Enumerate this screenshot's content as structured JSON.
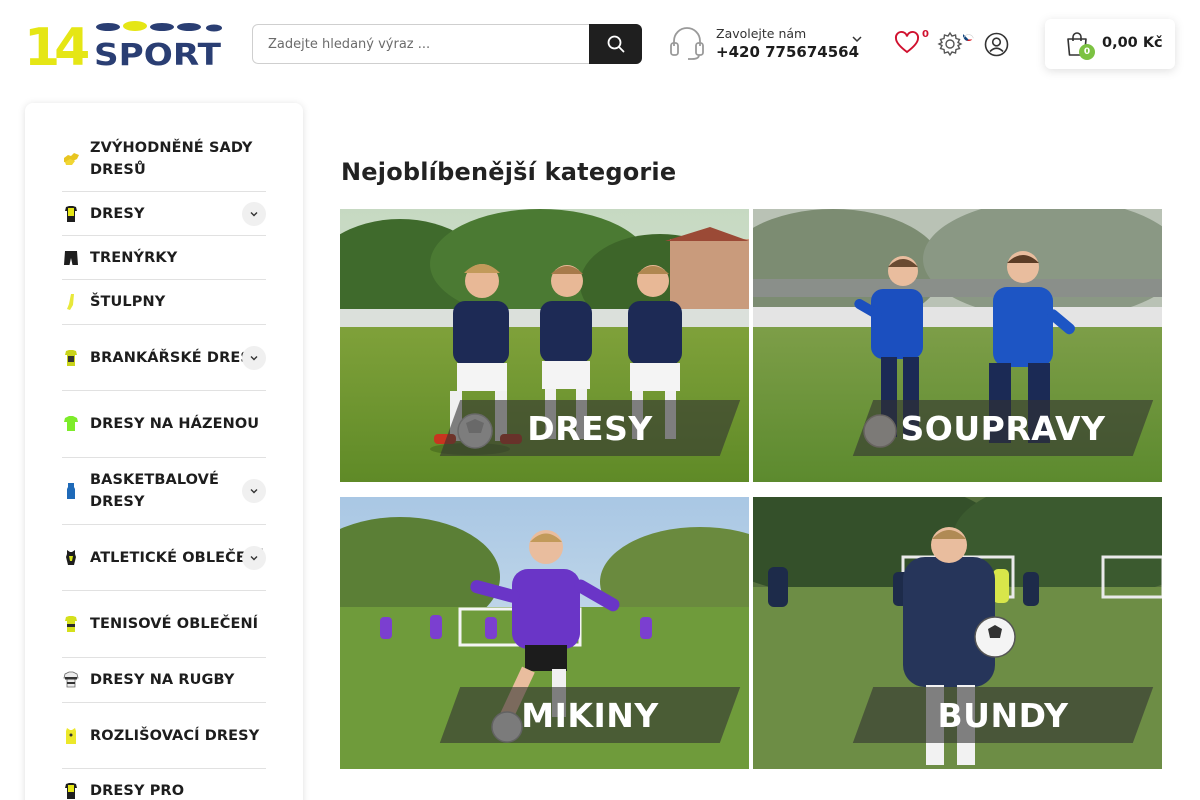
{
  "header": {
    "logo_text_top": "14",
    "logo_text_bottom": "SPORT",
    "search_placeholder": "Zadejte hledaný výraz ...",
    "phone_label": "Zavolejte nám",
    "phone_number": "+420 775674564",
    "wishlist_count": "0",
    "cart_count": "0",
    "cart_total": "0,00 Kč"
  },
  "sidebar": {
    "items": [
      {
        "label": "ZVÝHODNĚNÉ SADY DRESŮ",
        "icon": "bundle-jerseys-icon",
        "expandable": false
      },
      {
        "label": "DRESY",
        "icon": "jersey-icon",
        "expandable": true
      },
      {
        "label": "TRENÝRKY",
        "icon": "shorts-icon",
        "expandable": false
      },
      {
        "label": "ŠTULPNY",
        "icon": "socks-icon",
        "expandable": false
      },
      {
        "label": "BRANKÁŘSKÉ DRESY",
        "icon": "goalkeeper-jersey-icon",
        "expandable": true
      },
      {
        "label": "DRESY NA HÁZENOU",
        "icon": "handball-jersey-icon",
        "expandable": false
      },
      {
        "label": "BASKETBALOVÉ DRESY",
        "icon": "basketball-jersey-icon",
        "expandable": true
      },
      {
        "label": "ATLETICKÉ OBLEČENÍ",
        "icon": "athletic-clothing-icon",
        "expandable": true
      },
      {
        "label": "TENISOVÉ OBLEČENÍ",
        "icon": "tennis-clothing-icon",
        "expandable": false
      },
      {
        "label": "DRESY NA RUGBY",
        "icon": "rugby-jersey-icon",
        "expandable": false
      },
      {
        "label": "ROZLIŠOVACÍ DRESY",
        "icon": "training-bib-icon",
        "expandable": false
      },
      {
        "label": "DRESY PRO",
        "icon": "jersey-icon",
        "expandable": false
      }
    ]
  },
  "main": {
    "heading": "Nejoblíbenější kategorie",
    "categories": [
      {
        "label": "DRESY"
      },
      {
        "label": "SOUPRAVY"
      },
      {
        "label": "MIKINY"
      },
      {
        "label": "BUNDY"
      }
    ]
  },
  "colors": {
    "brand_yellow": "#e5e615",
    "brand_navy": "#2a3e73",
    "badge_green": "#7cc242",
    "wish_red": "#d0102e"
  }
}
